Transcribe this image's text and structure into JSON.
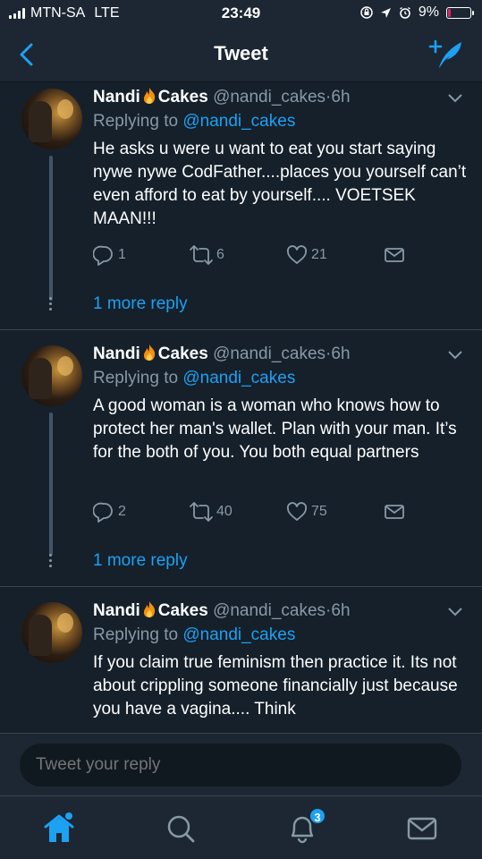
{
  "status_bar": {
    "carrier": "MTN-SA",
    "network": "LTE",
    "time": "23:49",
    "battery": "9%"
  },
  "header": {
    "title": "Tweet"
  },
  "tweets": [
    {
      "name": "Nandi",
      "name_suffix": "Cakes",
      "handle": "@nandi_cakes",
      "separator": "·",
      "time": "6h",
      "replying_label": "Replying to",
      "replying_to": "@nandi_cakes",
      "text": "He asks u were u want to eat you start saying nywe nywe CodFather....places you yourself can’t even afford to eat by yourself.... VOETSEK MAAN!!!",
      "replies": "1",
      "retweets": "6",
      "likes": "21",
      "more_replies": "1 more reply"
    },
    {
      "name": "Nandi",
      "name_suffix": "Cakes",
      "handle": "@nandi_cakes",
      "separator": "·",
      "time": "6h",
      "replying_label": "Replying to",
      "replying_to": "@nandi_cakes",
      "text": "A good woman is a woman who knows how to protect her man's wallet. Plan with your man. It’s for the both of you. You both equal partners",
      "replies": "2",
      "retweets": "40",
      "likes": "75",
      "more_replies": "1 more reply"
    },
    {
      "name": "Nandi",
      "name_suffix": "Cakes",
      "handle": "@nandi_cakes",
      "separator": "·",
      "time": "6h",
      "replying_label": "Replying to",
      "replying_to": "@nandi_cakes",
      "text": "If you claim true feminism then practice it. Its not about crippling someone financially just because you have a vagina.... Think"
    }
  ],
  "reply_bar": {
    "placeholder": "Tweet your reply"
  },
  "tab_bar": {
    "notifications_badge": "3"
  },
  "colors": {
    "background": "#15202b",
    "accent": "#1da1f2",
    "secondary_text": "#8899a6",
    "battery_low": "#e0245e"
  },
  "icons": [
    "back-arrow-icon",
    "compose-tweet-icon",
    "flame-emoji-icon",
    "chevron-down-icon",
    "reply-icon",
    "retweet-icon",
    "like-icon",
    "share-icon",
    "home-icon",
    "search-icon",
    "notifications-icon",
    "messages-icon"
  ]
}
